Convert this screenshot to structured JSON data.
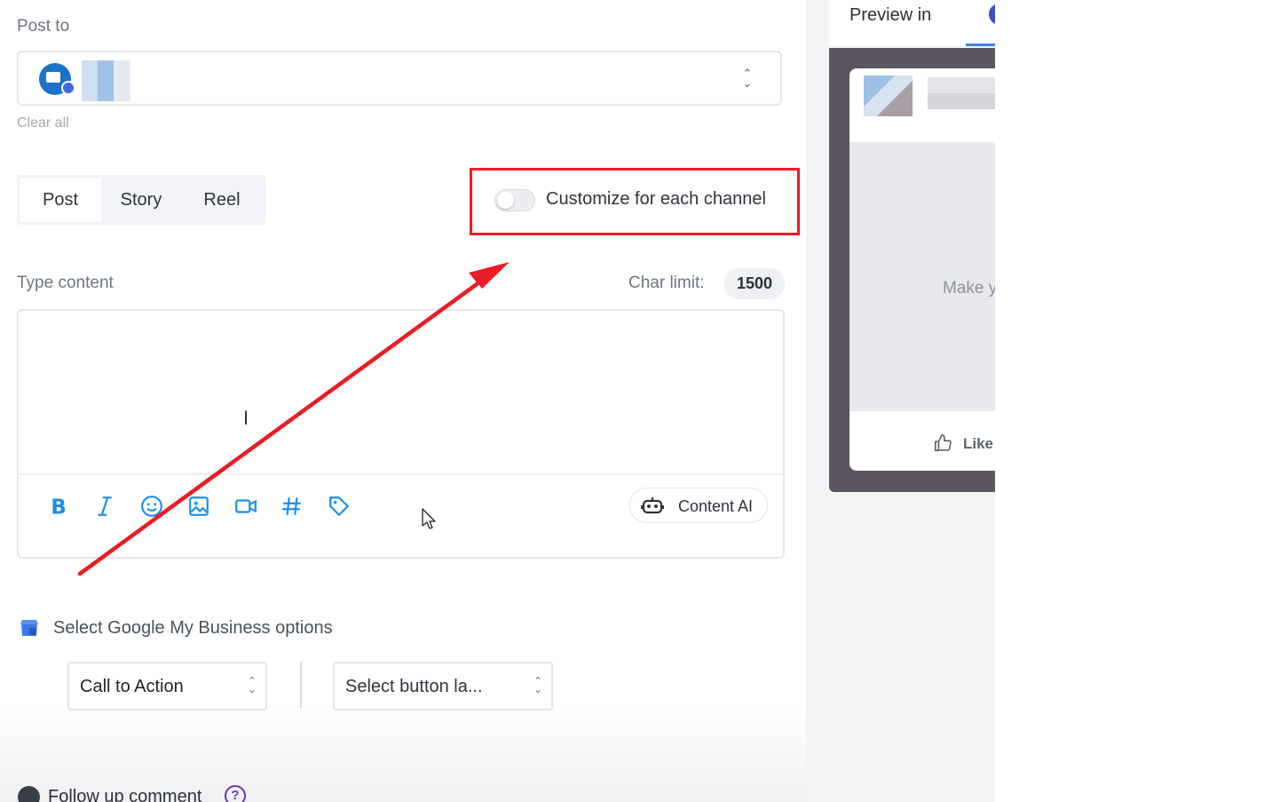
{
  "composer": {
    "post_to_label": "Post to",
    "clear_all": "Clear all",
    "tabs": [
      {
        "label": "Post",
        "active": true
      },
      {
        "label": "Story",
        "active": false
      },
      {
        "label": "Reel",
        "active": false
      }
    ],
    "customize": {
      "label": "Customize for each channel",
      "enabled": false
    },
    "content_label": "Type content",
    "char_limit_label": "Char limit:",
    "char_limit_value": "1500",
    "content_ai_label": "Content AI",
    "editor_value": ""
  },
  "toolbar_icons": [
    "bold-icon",
    "italic-icon",
    "emoji-icon",
    "image-icon",
    "video-icon",
    "hashtag-icon",
    "tag-icon"
  ],
  "gmb": {
    "label": "Select Google My Business options",
    "cta_select": "Call to Action",
    "button_label_select": "Select button la..."
  },
  "follow_up": {
    "label": "Follow up comment",
    "help": "?"
  },
  "preview": {
    "title": "Preview in",
    "media_text": "Make y",
    "like_label": "Like"
  },
  "colors": {
    "annotation_red": "#ea1c24",
    "toolbar_blue": "#1e8ee6",
    "help_purple": "#6b3aa8"
  }
}
